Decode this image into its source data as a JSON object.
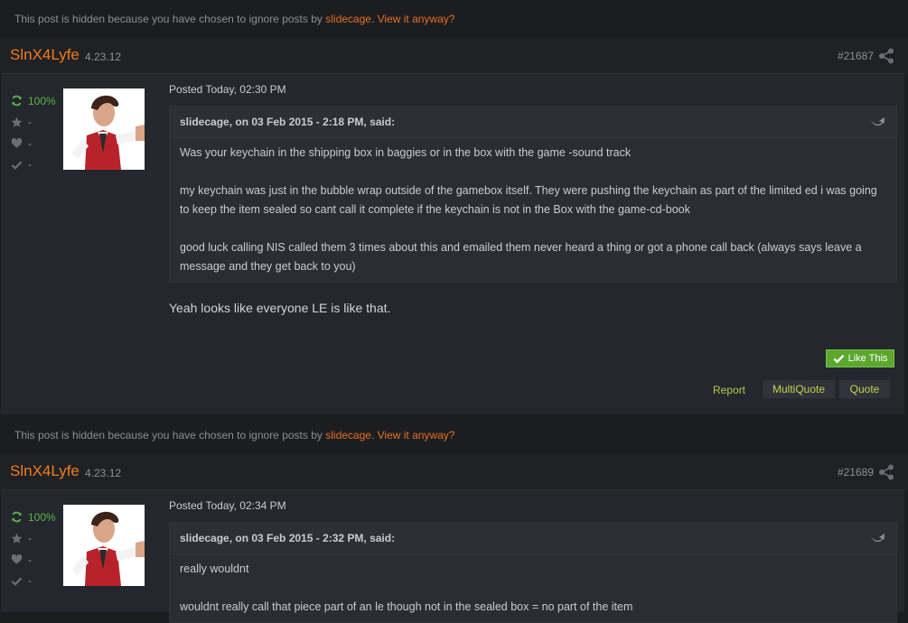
{
  "notice": {
    "text": "This post is hidden because you have chosen to ignore posts by",
    "user": "slidecage",
    "link": "View it anyway?"
  },
  "posts": [
    {
      "author": "SlnX4Lyfe",
      "date": "4.23.12",
      "number": "#21687",
      "stats": {
        "reputation": "100%",
        "star": "-",
        "heart": "-",
        "check": "-"
      },
      "posted": "Posted Today, 02:30 PM",
      "quote_header": "slidecage, on 03 Feb 2015 - 2:18 PM, said:",
      "quote_paragraphs": [
        "Was your keychain  in the shipping box in baggies  or    in the box with the game -sound track",
        "my keychain was just  in  the bubble wrap  outside of the gamebox itself.   They were pushing the keychain as  part of the limited ed i was going to keep the item sealed so cant call it complete if the keychain is not in the  Box with the game-cd-book",
        "good luck calling NIS  called them 3 times about this and emailed them  never heard a thing or got a phone call back (always says leave a message and they get back to you)"
      ],
      "reply": "Yeah looks like everyone LE is like that.",
      "like_label": "Like This",
      "report_label": "Report",
      "multiquote_label": "MultiQuote",
      "quote_label": "Quote"
    },
    {
      "author": "SlnX4Lyfe",
      "date": "4.23.12",
      "number": "#21689",
      "stats": {
        "reputation": "100%",
        "star": "-",
        "heart": "-",
        "check": "-"
      },
      "posted": "Posted Today, 02:34 PM",
      "quote_header": "slidecage, on 03 Feb 2015 - 2:32 PM, said:",
      "quote_paragraphs": [
        "really wouldnt",
        "wouldnt really  call that piece part of  an le though  not in the sealed box = no part of the item"
      ]
    }
  ],
  "colors": {
    "author": "#f07c1b",
    "link": "#e8701e",
    "like": "#5ca82e",
    "rep": "#5ab54a"
  }
}
